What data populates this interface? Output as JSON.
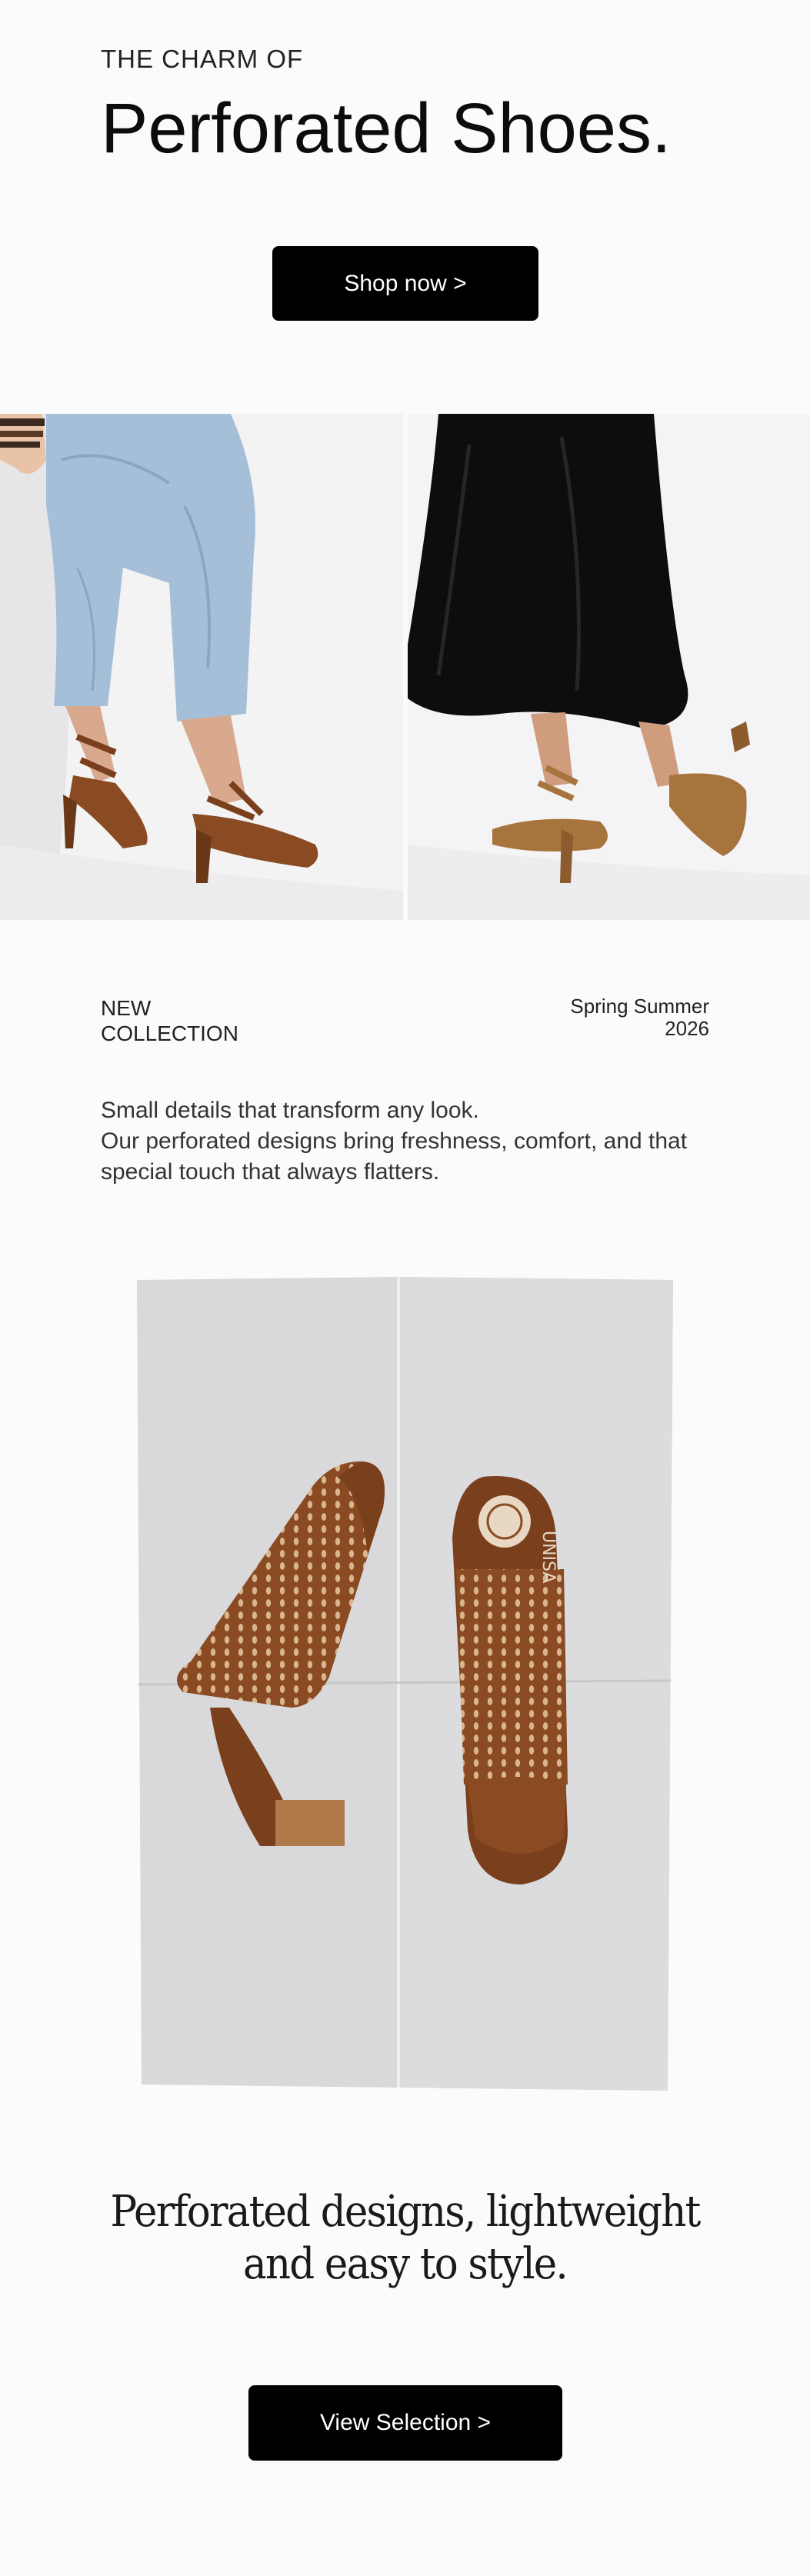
{
  "hero": {
    "eyebrow": "THE CHARM OF",
    "title": "Perforated Shoes.",
    "cta_label": "Shop now >"
  },
  "collection": {
    "label": "NEW\nCOLLECTION",
    "season": "Spring Summer\n2026",
    "intro_line1": "Small details that transform any look.",
    "intro_line2": "Our perforated designs bring freshness, comfort, and that special touch that always flatters."
  },
  "product": {
    "brand_mark": "UNISA"
  },
  "closing": {
    "tagline": "Perforated designs, lightweight and easy to style.",
    "cta_label": "View Selection >"
  },
  "colors": {
    "background": "#fbfbfb",
    "button": "#000000",
    "button_text": "#ffffff",
    "leather_brown": "#8a4a22",
    "denim": "#9bb6d3"
  }
}
